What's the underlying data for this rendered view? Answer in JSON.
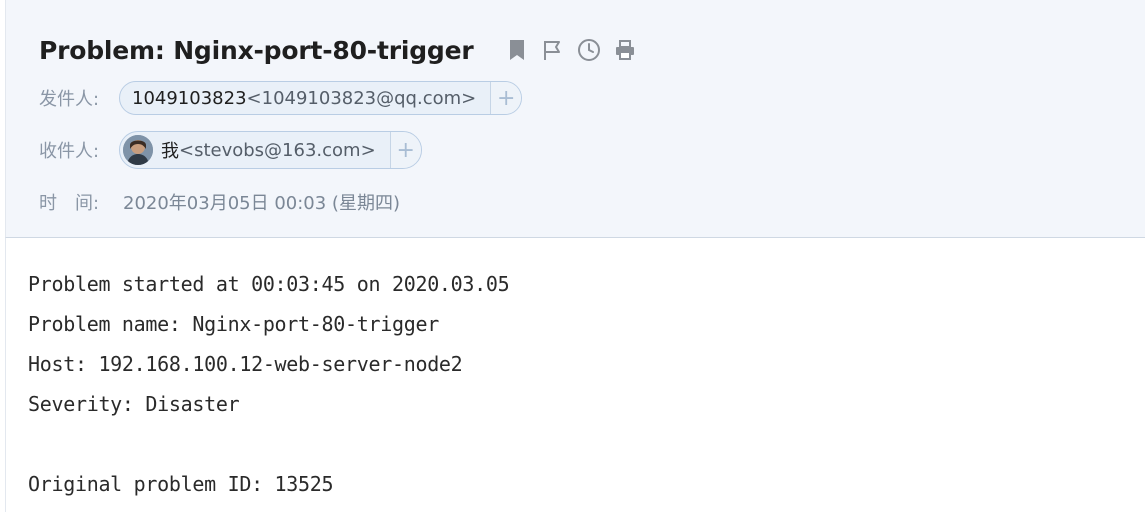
{
  "header": {
    "subject": "Problem: Nginx-port-80-trigger",
    "icons": [
      "bookmark-icon",
      "flag-icon",
      "clock-icon",
      "print-icon"
    ]
  },
  "from": {
    "label": "发件人:",
    "name": "1049103823",
    "email": "<1049103823@qq.com>",
    "add": "+"
  },
  "to": {
    "label": "收件人:",
    "name": "我",
    "email": "<stevobs@163.com>",
    "add": "+"
  },
  "time": {
    "label": "时　间:",
    "value": "2020年03月05日 00:03 (星期四)"
  },
  "body": {
    "lines": [
      "Problem started at 00:03:45 on 2020.03.05",
      "Problem name: Nginx-port-80-trigger",
      "Host: 192.168.100.12-web-server-node2",
      "Severity: Disaster",
      "",
      "Original problem ID: 13525"
    ]
  },
  "colors": {
    "header_bg": "#f3f6fb",
    "chip_bg": "#e9f0f8",
    "chip_border": "#b9cde4",
    "label": "#8a96a6",
    "icon": "#8a8f96"
  }
}
